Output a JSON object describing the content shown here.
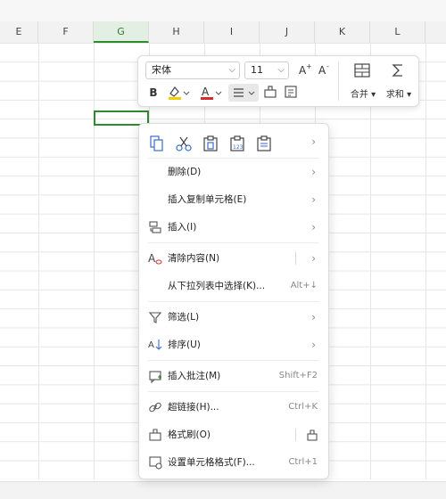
{
  "columns": [
    {
      "label": "E"
    },
    {
      "label": "F"
    },
    {
      "label": "G"
    },
    {
      "label": "H"
    },
    {
      "label": "I"
    },
    {
      "label": "J"
    },
    {
      "label": "K"
    },
    {
      "label": "L"
    }
  ],
  "mini_toolbar": {
    "font_name": "宋体",
    "font_size": "11",
    "merge_label": "合并",
    "sum_label": "求和",
    "bold_label": "B",
    "font_color": "#d92b2b",
    "highlight_color": "#f2d000"
  },
  "menu": {
    "paste_icons": [
      "copy-icon",
      "cut-icon",
      "paste-icon",
      "paste-values-icon",
      "paste-formulas-icon"
    ],
    "items": [
      {
        "label": "删除(D)",
        "shortcut": ""
      },
      {
        "label": "插入复制单元格(E)",
        "shortcut": ""
      },
      {
        "label": "插入(I)",
        "shortcut": ""
      },
      {
        "label": "清除内容(N)",
        "shortcut": ""
      },
      {
        "label": "从下拉列表中选择(K)...",
        "shortcut": "Alt+↓"
      },
      {
        "label": "筛选(L)",
        "shortcut": ""
      },
      {
        "label": "排序(U)",
        "shortcut": ""
      },
      {
        "label": "插入批注(M)",
        "shortcut": "Shift+F2"
      },
      {
        "label": "超链接(H)...",
        "shortcut": "Ctrl+K"
      },
      {
        "label": "格式刷(O)",
        "shortcut": ""
      },
      {
        "label": "设置单元格格式(F)...",
        "shortcut": "Ctrl+1"
      }
    ]
  }
}
